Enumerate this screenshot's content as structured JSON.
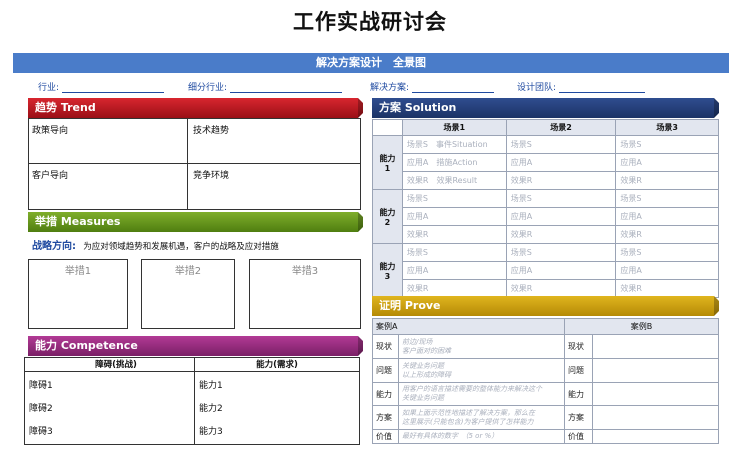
{
  "page_title": "工作实战研讨会",
  "banner": "解决方案设计　全景图",
  "fields": {
    "industry": "行业:",
    "sub_industry": "细分行业:",
    "solution": "解决方案:",
    "design_team": "设计团队:"
  },
  "trend": {
    "header": "趋势 Trend",
    "cells": [
      "政策导向",
      "技术趋势",
      "客户导向",
      "竞争环境"
    ]
  },
  "measures": {
    "header": "举措 Measures",
    "direction_label": "战略方向:",
    "direction_text": "为应对领域趋势和发展机遇，客户的战略及应对措施",
    "boxes": [
      "举措1",
      "举措2",
      "举措3"
    ]
  },
  "competence": {
    "header": "能力 Competence",
    "col1": "障碍(挑战)",
    "col2": "能力(需求)",
    "rows1": [
      "障碍1",
      "障碍2",
      "障碍3"
    ],
    "rows2": [
      "能力1",
      "能力2",
      "能力3"
    ]
  },
  "solution": {
    "header": "方案 Solution",
    "columns": [
      "场景1",
      "场景2",
      "场景3"
    ],
    "groups": [
      {
        "label": "能力\n1",
        "rows": [
          [
            "场景S　事件Situation",
            "场景S",
            "场景S"
          ],
          [
            "应用A　措施Action",
            "应用A",
            "应用A"
          ],
          [
            "效果R　效果Result",
            "效果R",
            "效果R"
          ]
        ]
      },
      {
        "label": "能力\n2",
        "rows": [
          [
            "场景S",
            "场景S",
            "场景S"
          ],
          [
            "应用A",
            "应用A",
            "应用A"
          ],
          [
            "效果R",
            "效果R",
            "效果R"
          ]
        ]
      },
      {
        "label": "能力\n3",
        "rows": [
          [
            "场景S",
            "场景S",
            "场景S"
          ],
          [
            "应用A",
            "应用A",
            "应用A"
          ],
          [
            "效果R",
            "效果R",
            "效果R"
          ]
        ]
      }
    ]
  },
  "prove": {
    "header": "证明 Prove",
    "case_a": "案例A",
    "case_b": "案例B",
    "rows": [
      {
        "label": "现状",
        "hint": "前边/现场\n客户面对的困难"
      },
      {
        "label": "问题",
        "hint": "关键业务问题\n以上形成的障碍"
      },
      {
        "label": "能力",
        "hint": "用客户的语言描述需要的整体能力来解决这个\n关键业务问题"
      },
      {
        "label": "方案",
        "hint": "如果上面示范性地描述了解决方案，那么在\n这里展示(只能包含)为客户提供了怎样能力"
      },
      {
        "label": "价值",
        "hint": "最好有具体的数字　（5 or %）"
      }
    ]
  }
}
